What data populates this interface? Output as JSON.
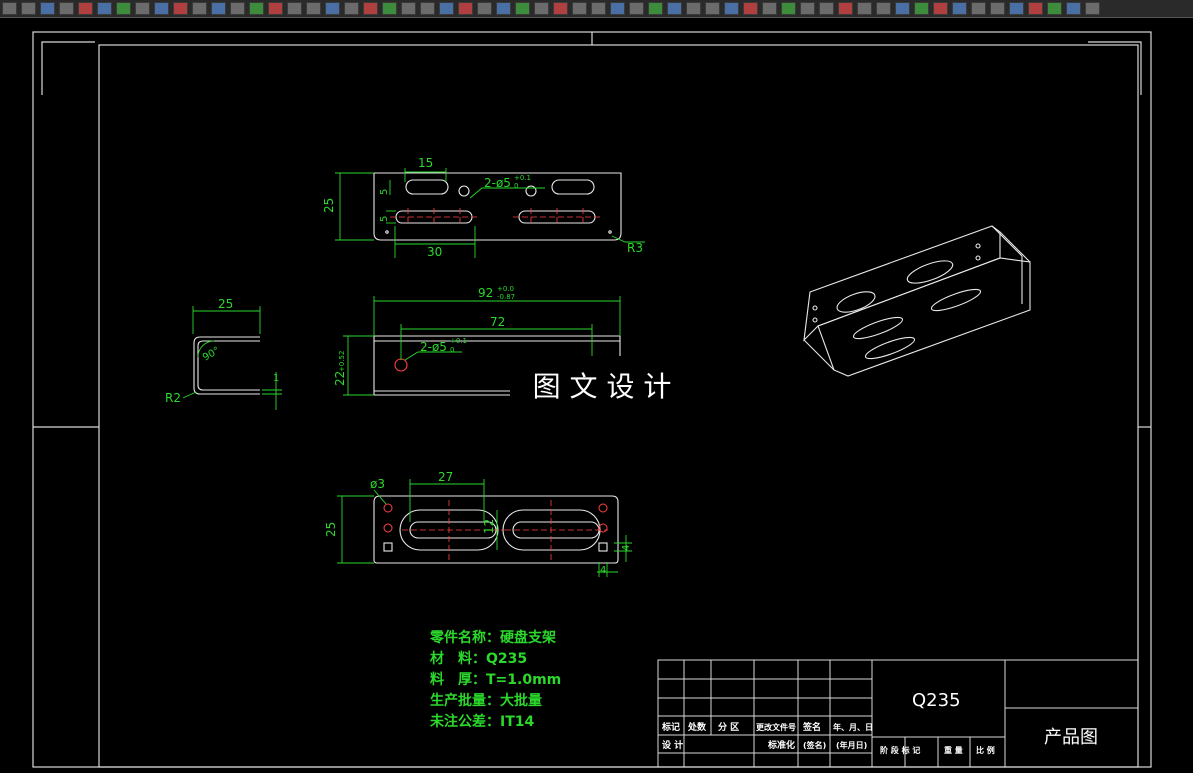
{
  "toolbar": {
    "icons": [
      "cad-tool-icon"
    ]
  },
  "drawing": {
    "dims": {
      "top_15": "15",
      "top_25": "25",
      "top_5a": "5",
      "top_5b": "5",
      "top_30": "30",
      "top_r3": "R3",
      "top_hole": "2-ø5",
      "top_hole_tol_upper": "+0.1",
      "top_hole_tol_lower": "0",
      "mid_92": "92",
      "mid_92_tol_upper": "+0.0",
      "mid_92_tol_lower": "-0.87",
      "mid_72": "72",
      "mid_22": "22",
      "mid_22_tol": "+0.52",
      "mid_hole": "2-ø5",
      "mid_hole_tol_upper": "+0.1",
      "mid_hole_tol_lower": "0",
      "side_25": "25",
      "side_90": "90°",
      "side_r2": "R2",
      "side_1": "1",
      "bot_27": "27",
      "bot_o3": "ø3",
      "bot_25": "25",
      "bot_12": "12",
      "bot_4a": "4",
      "bot_4b": "4"
    },
    "watermark": "图 文 设 计",
    "spec": {
      "line1": "零件名称：硬盘支架",
      "line2": "材　料：Q235",
      "line3": "料　厚：T=1.0mm",
      "line4": "生产批量：大批量",
      "line5": "未注公差：IT14"
    },
    "title_block": {
      "material": "Q235",
      "drawing_name": "产品图",
      "h_mark": "标记",
      "h_count": "处数",
      "h_zone": "分 区",
      "h_change_doc": "更改文件号",
      "h_sign": "签名",
      "h_date": "年、月、日",
      "r_design": "设 计",
      "r_standard": "标准化",
      "r_sign": "(签名)",
      "r_date": "(年月日)",
      "r_stage": "阶 段 标 记",
      "r_weight": "重 量",
      "r_scale": "比 例"
    }
  }
}
